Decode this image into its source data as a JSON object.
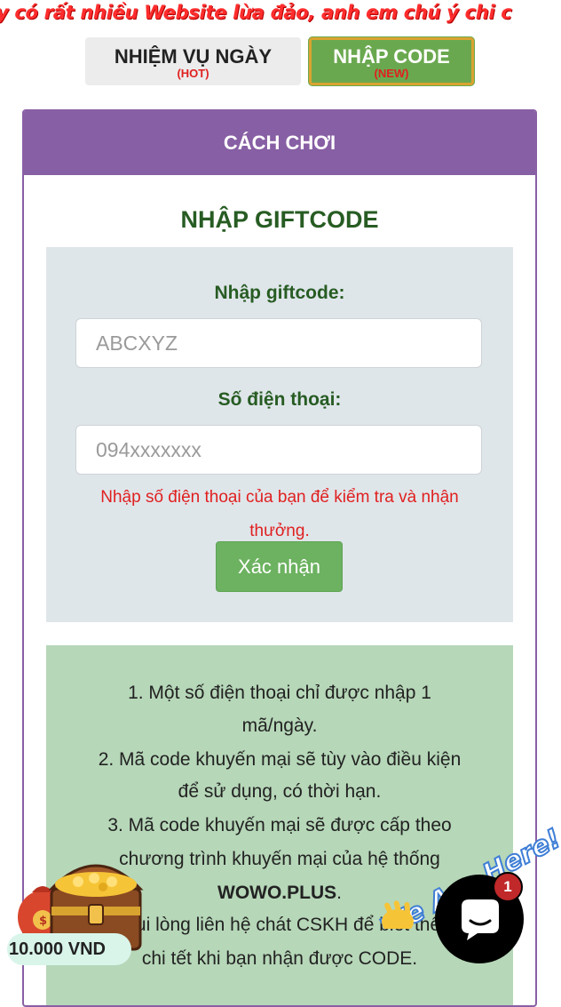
{
  "marquee": {
    "text": "y có rất nhiều Website lừa đảo, anh em chú ý chi c"
  },
  "tabs": [
    {
      "label": "NHIỆM VỤ NGÀY",
      "tag": "(HOT)"
    },
    {
      "label": "NHẬP CODE",
      "tag": "(NEW)"
    }
  ],
  "card": {
    "header": "CÁCH CHƠI",
    "title": "NHẬP GIFTCODE"
  },
  "form": {
    "giftcode_label": "Nhập giftcode:",
    "giftcode_placeholder": "ABCXYZ",
    "phone_label": "Số điện thoại:",
    "phone_placeholder": "094xxxxxxx",
    "hint": "Nhập số điện thoại của bạn để kiểm tra và nhận thưởng.",
    "submit": "Xác nhận"
  },
  "rules": {
    "lines": [
      "1. Một số điện thoại chỉ được nhập 1",
      "mã/ngày.",
      "2. Mã code khuyến mại sẽ tùy vào điều kiện",
      "để sử dụng, có thời hạn.",
      "3. Mã code khuyến mại sẽ được cấp theo",
      "chương trình khuyến mại của hệ thống",
      "WOWO.PLUS",
      "4. Vui lòng liên hệ chát CSKH để biết thêm",
      "chi tết khi bạn nhận được CODE."
    ]
  },
  "widgets": {
    "prize_amount": "10.000 VND",
    "we_are_here": "We Are Here!",
    "chat_badge_count": "1"
  },
  "colors": {
    "header_purple": "#875fa4",
    "tab_green": "#6aa84f",
    "title_green": "#275c23",
    "alert_red": "#e02020",
    "form_bg": "#dfe6ea",
    "rules_bg": "#b6d7b8"
  },
  "icons": [
    "treasure-chest-icon",
    "money-bag-icon",
    "waving-hand-icon",
    "chat-bubble-icon"
  ]
}
